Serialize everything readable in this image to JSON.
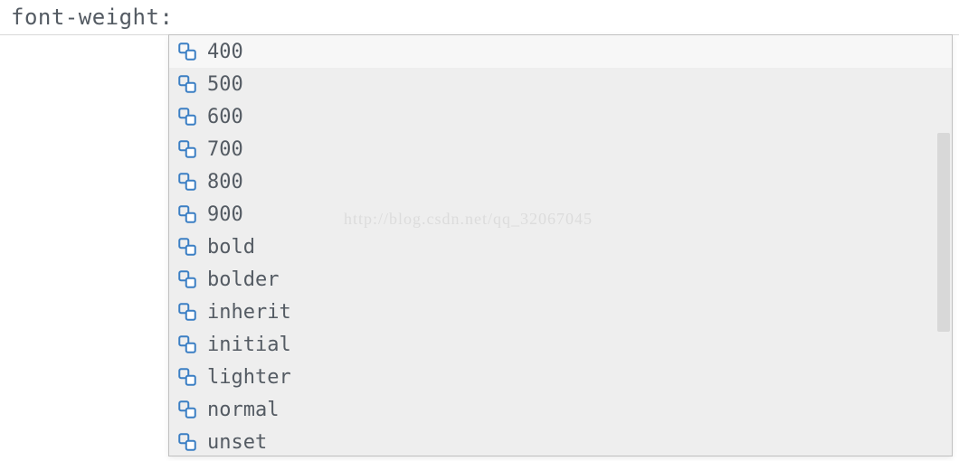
{
  "editor": {
    "line_text": "font-weight:"
  },
  "autocomplete": {
    "selected_index": 0,
    "items": [
      {
        "label": "400"
      },
      {
        "label": "500"
      },
      {
        "label": "600"
      },
      {
        "label": "700"
      },
      {
        "label": "800"
      },
      {
        "label": "900"
      },
      {
        "label": "bold"
      },
      {
        "label": "bolder"
      },
      {
        "label": "inherit"
      },
      {
        "label": "initial"
      },
      {
        "label": "lighter"
      },
      {
        "label": "normal"
      },
      {
        "label": "unset"
      }
    ]
  },
  "watermark": {
    "text": "http://blog.csdn.net/qq_32067045"
  }
}
